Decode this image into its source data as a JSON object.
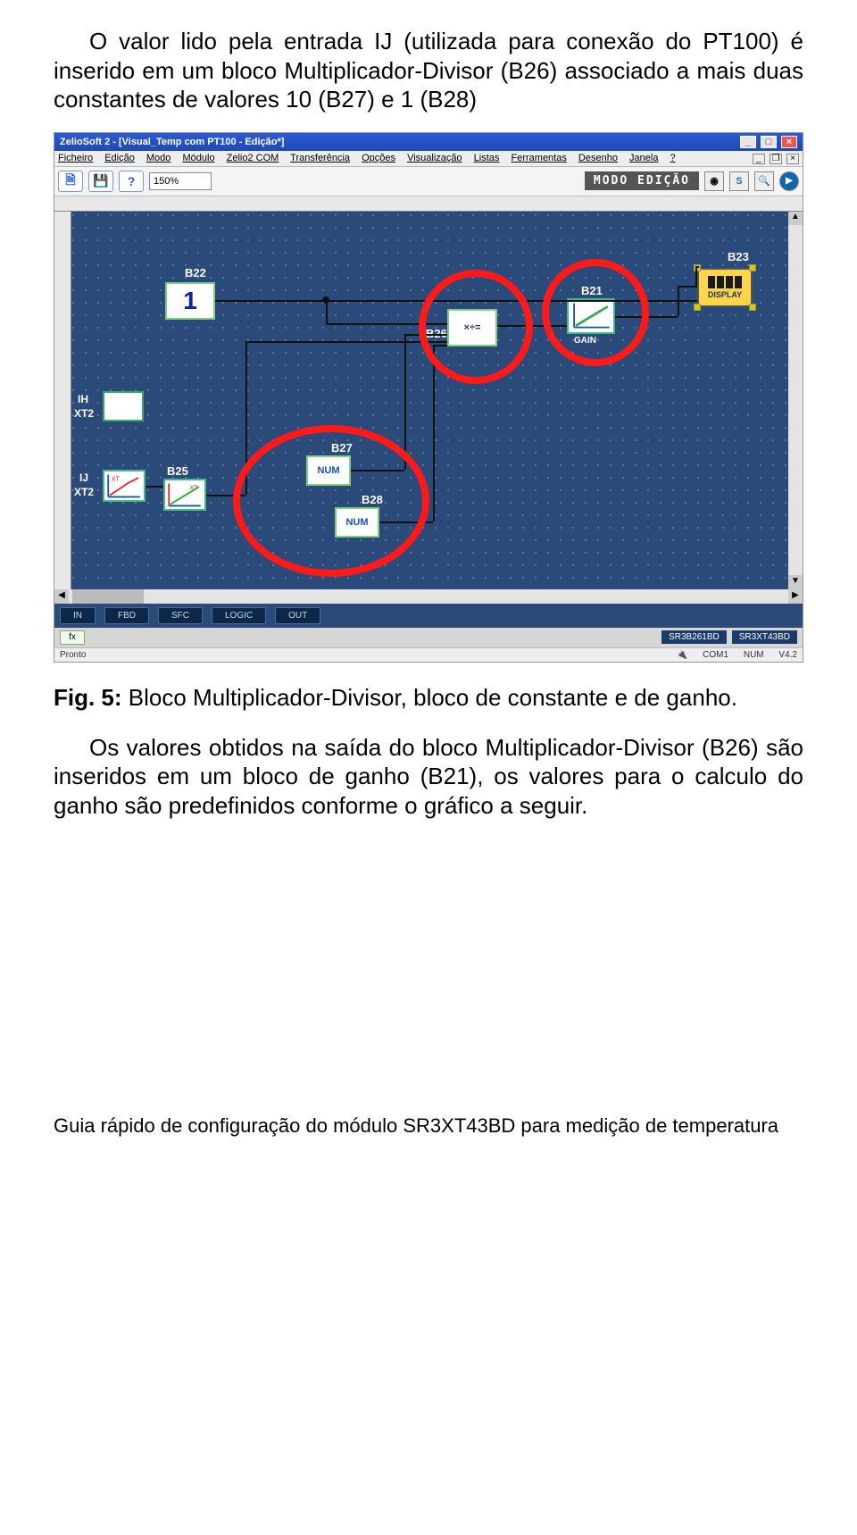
{
  "paragraphs": {
    "p1": "O valor lido pela entrada IJ (utilizada para conexão do PT100) é inserido em um bloco Multiplicador-Divisor (B26) associado a mais duas constantes de valores 10 (B27) e 1 (B28)",
    "p2": "Os valores obtidos na saída do bloco Multiplicador-Divisor (B26) são inseridos em um bloco de ganho (B21), os valores para o calculo do ganho são predefinidos conforme o gráfico a seguir."
  },
  "caption": {
    "label": "Fig. 5:",
    "text": " Bloco Multiplicador-Divisor, bloco de constante e de ganho."
  },
  "footer": "Guia rápido de configuração do módulo SR3XT43BD para medição de temperatura",
  "screenshot": {
    "window_title": "ZelioSoft 2 - [Visual_Temp com PT100 - Edição*]",
    "menubar": [
      "Ficheiro",
      "Edição",
      "Modo",
      "Módulo",
      "Zelio2 COM",
      "Transferência",
      "Opções",
      "Visualização",
      "Listas",
      "Ferramentas",
      "Desenho",
      "Janela",
      "?"
    ],
    "zoom": "150%",
    "mode_label": "MODO EDIÇÃO",
    "tb_s": "S",
    "tabs": [
      "IN",
      "FBD",
      "SFC",
      "LOGIC",
      "OUT"
    ],
    "ports": {
      "ih": "IH",
      "xt2a": "XT2",
      "ij": "IJ",
      "xt2b": "XT2"
    },
    "blocks": {
      "b22_label": "B22",
      "b22_value": "1",
      "b25_label": "B25",
      "b27_label": "B27",
      "b27_text": "NUM",
      "b28_label": "B28",
      "b28_text": "NUM",
      "b26_label": "B26",
      "b26_text": "×÷=",
      "b21_label": "B21",
      "b21_text": "GAIN",
      "b23_label": "B23",
      "b23_text": "DISPLAY"
    },
    "fnbadges": [
      "SR3B261BD",
      "SR3XT43BD"
    ],
    "status": {
      "left": "Pronto",
      "com": "COM1",
      "num": "NUM",
      "ver": "V4.2"
    }
  }
}
